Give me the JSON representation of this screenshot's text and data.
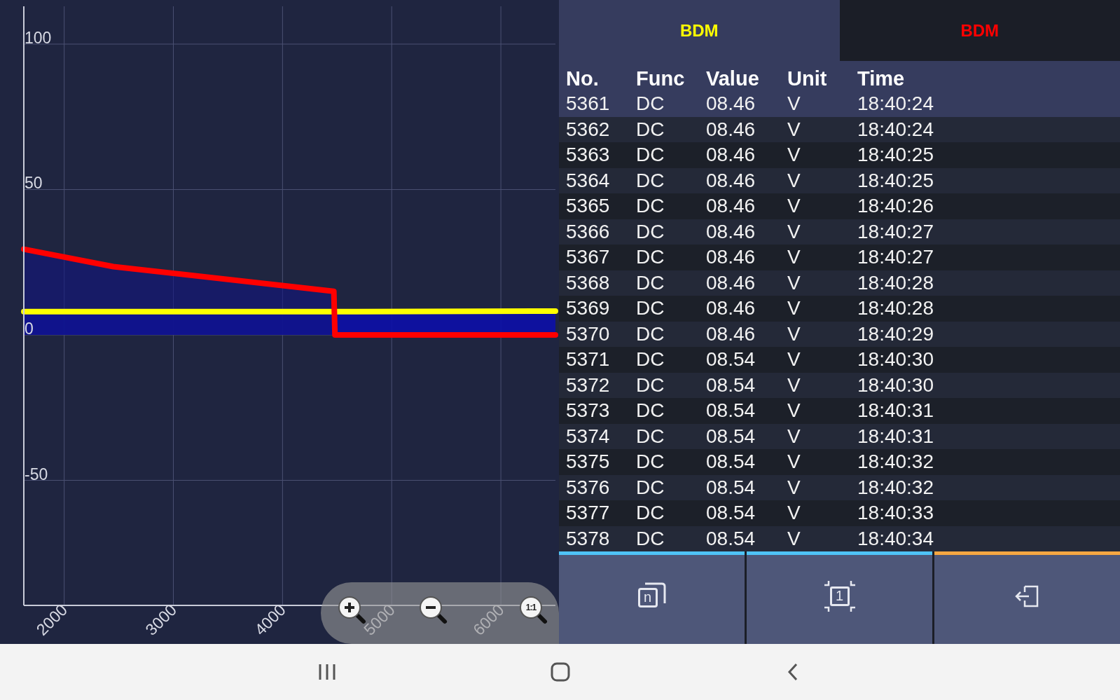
{
  "chart": {
    "chart_data": {
      "type": "line",
      "grid": true,
      "xlim": [
        1630,
        6500
      ],
      "ylim": [
        -93,
        113
      ],
      "xticks": [
        2000,
        3000,
        4000,
        5000,
        6000
      ],
      "yticks": [
        -50,
        0,
        50,
        100
      ],
      "x": [
        1630,
        2450,
        4470,
        4480,
        6500
      ],
      "series": [
        {
          "color": "#ff0000",
          "values": [
            29.5,
            23.5,
            15,
            0,
            0
          ]
        },
        {
          "color": "#ffff00",
          "values": [
            8,
            8,
            8,
            8,
            8.2
          ]
        }
      ]
    }
  },
  "zoom_controls": [
    {
      "kind": "zoom-in"
    },
    {
      "kind": "zoom-out"
    },
    {
      "kind": "reset",
      "label": "1:1"
    }
  ],
  "tabs": [
    {
      "label": "BDM",
      "color": "#ffff00",
      "selected": true
    },
    {
      "label": "BDM",
      "color": "#ff0000",
      "selected": false
    }
  ],
  "table": {
    "columns": [
      "No.",
      "Func",
      "Value",
      "Unit",
      "Time"
    ],
    "rows": [
      [
        "5361",
        "DC",
        "08.46",
        "V",
        "18:40:24"
      ],
      [
        "5362",
        "DC",
        "08.46",
        "V",
        "18:40:24"
      ],
      [
        "5363",
        "DC",
        "08.46",
        "V",
        "18:40:25"
      ],
      [
        "5364",
        "DC",
        "08.46",
        "V",
        "18:40:25"
      ],
      [
        "5365",
        "DC",
        "08.46",
        "V",
        "18:40:26"
      ],
      [
        "5366",
        "DC",
        "08.46",
        "V",
        "18:40:27"
      ],
      [
        "5367",
        "DC",
        "08.46",
        "V",
        "18:40:27"
      ],
      [
        "5368",
        "DC",
        "08.46",
        "V",
        "18:40:28"
      ],
      [
        "5369",
        "DC",
        "08.46",
        "V",
        "18:40:28"
      ],
      [
        "5370",
        "DC",
        "08.46",
        "V",
        "18:40:29"
      ],
      [
        "5371",
        "DC",
        "08.54",
        "V",
        "18:40:30"
      ],
      [
        "5372",
        "DC",
        "08.54",
        "V",
        "18:40:30"
      ],
      [
        "5373",
        "DC",
        "08.54",
        "V",
        "18:40:31"
      ],
      [
        "5374",
        "DC",
        "08.54",
        "V",
        "18:40:31"
      ],
      [
        "5375",
        "DC",
        "08.54",
        "V",
        "18:40:32"
      ],
      [
        "5376",
        "DC",
        "08.54",
        "V",
        "18:40:32"
      ],
      [
        "5377",
        "DC",
        "08.54",
        "V",
        "18:40:33"
      ],
      [
        "5378",
        "DC",
        "08.54",
        "V",
        "18:40:34"
      ]
    ]
  },
  "toolbar": [
    {
      "kind": "copies",
      "glyph": "n",
      "color": "#4fc3f7"
    },
    {
      "kind": "frame",
      "glyph": "1",
      "color": "#4fc3f7"
    },
    {
      "kind": "exit",
      "color": "#f5a742"
    }
  ]
}
